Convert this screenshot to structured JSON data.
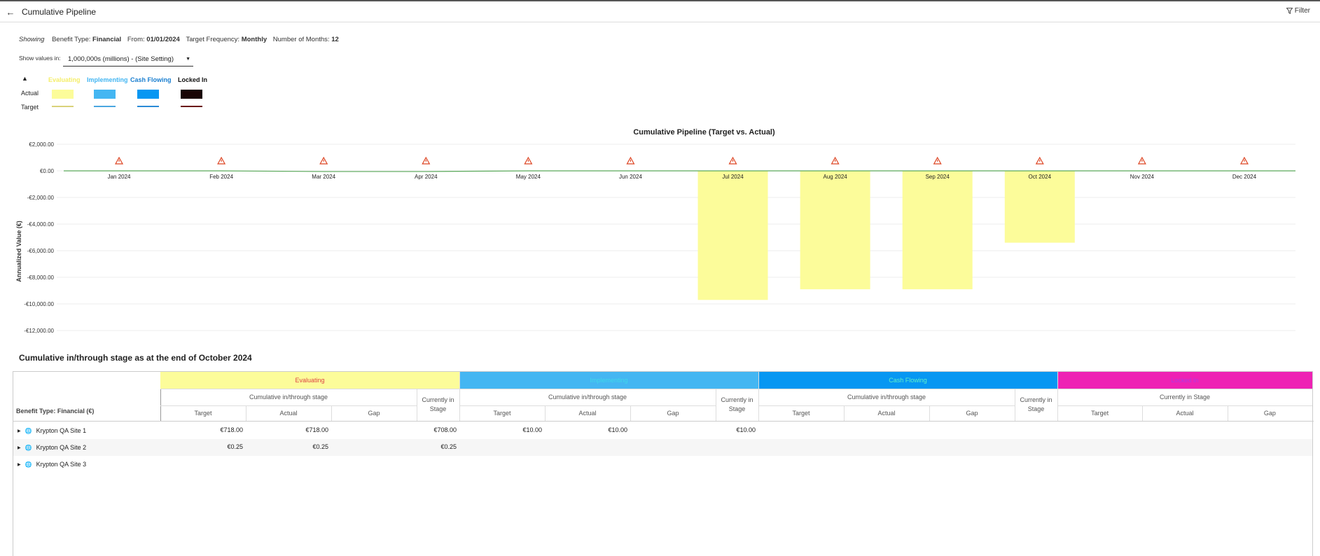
{
  "header": {
    "title": "Cumulative Pipeline",
    "filter_label": "Filter"
  },
  "showing": {
    "label": "Showing",
    "benefit_type_key": "Benefit Type:",
    "benefit_type": "Financial",
    "from_key": "From:",
    "from": "01/01/2024",
    "frequency_key": "Target Frequency:",
    "frequency": "Monthly",
    "months_key": "Number of Months:",
    "months": "12"
  },
  "units": {
    "label": "Show values in:",
    "value": "1,000,000s (millions) - (Site Setting)"
  },
  "legend": {
    "actual_label": "Actual",
    "target_label": "Target",
    "stages": [
      {
        "name": "Evaluating",
        "color": "#fcfc9a",
        "text_color": "#f5ee6a",
        "target_color": "#d9d27a"
      },
      {
        "name": "Implementing",
        "color": "#44b6f2",
        "text_color": "#44b6f2",
        "target_color": "#4aa6e0"
      },
      {
        "name": "Cash Flowing",
        "color": "#0797f2",
        "text_color": "#1a7fd0",
        "target_color": "#2a8ad6"
      },
      {
        "name": "Locked In",
        "color": "#1a0505",
        "text_color": "#111111",
        "target_color": "#6a1010"
      }
    ]
  },
  "chart_data": {
    "type": "bar",
    "title": "Cumulative Pipeline (Target vs. Actual)",
    "ylabel": "Annualized Value  (€)",
    "xlabel": "",
    "categories": [
      "Jan 2024",
      "Feb 2024",
      "Mar 2024",
      "Apr 2024",
      "May 2024",
      "Jun 2024",
      "Jul 2024",
      "Aug 2024",
      "Sep 2024",
      "Oct 2024",
      "Nov 2024",
      "Dec 2024"
    ],
    "ylim": [
      -12000,
      2000
    ],
    "yticks": [
      2000,
      0,
      -2000,
      -4000,
      -6000,
      -8000,
      -10000,
      -12000
    ],
    "ytick_labels": [
      "€2,000.00",
      "€0.00",
      "-€2,000.00",
      "-€4,000.00",
      "-€6,000.00",
      "-€8,000.00",
      "-€10,000.00",
      "-€12,000.00"
    ],
    "series": [
      {
        "name": "Evaluating",
        "values": [
          0,
          0,
          0,
          0,
          0,
          0,
          -9700,
          -8900,
          -8900,
          -5400,
          0,
          0
        ],
        "color": "#fcfc9a"
      }
    ],
    "target_line": {
      "values": [
        0,
        0,
        -50,
        -50,
        0,
        0,
        0,
        0,
        0,
        0,
        0,
        0
      ],
      "color": "#5aa95a"
    },
    "warning_icons": true,
    "grid": true
  },
  "table": {
    "title": "Cumulative in/through stage as at the end of October 2024",
    "row_header": "Benefit Type: Financial (€)",
    "stages": [
      {
        "name": "Evaluating",
        "bg": "#fcfc9a",
        "fg": "#d44"
      },
      {
        "name": "Implementing",
        "bg": "#44b6f2",
        "fg": "#3fd8e8"
      },
      {
        "name": "Cash Flowing",
        "bg": "#0797f2",
        "fg": "#5ff0c8"
      },
      {
        "name": "Locked In",
        "bg": "#ee22b4",
        "fg": "#b03ae0"
      }
    ],
    "group_label": "Cumulative in/through stage",
    "current_label": "Currently in Stage",
    "col_target": "Target",
    "col_actual": "Actual",
    "col_gap": "Gap",
    "rows": [
      {
        "name": "Krypton QA Site 1",
        "values": [
          "€718.00",
          "€718.00",
          "",
          "€708.00",
          "€10.00",
          "€10.00",
          "",
          "€10.00",
          "",
          "",
          "",
          "",
          "",
          "",
          ""
        ]
      },
      {
        "name": "Krypton QA Site 2",
        "values": [
          "€0.25",
          "€0.25",
          "",
          "€0.25",
          "",
          "",
          "",
          "",
          "",
          "",
          "",
          "",
          "",
          "",
          ""
        ]
      },
      {
        "name": "Krypton QA Site 3",
        "values": [
          "",
          "",
          "",
          "",
          "",
          "",
          "",
          "",
          "",
          "",
          "",
          "",
          "",
          "",
          ""
        ]
      }
    ]
  }
}
